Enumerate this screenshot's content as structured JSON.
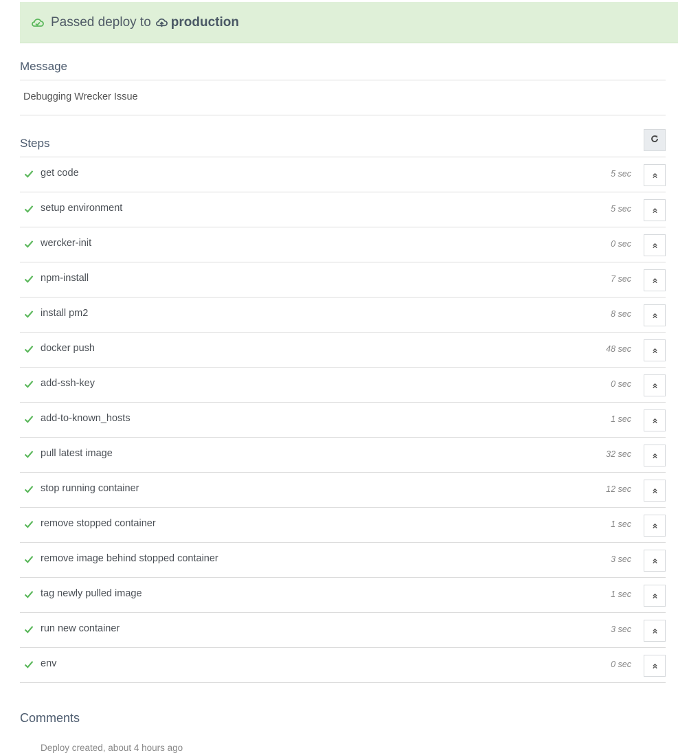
{
  "banner": {
    "status_text": "Passed deploy to",
    "target": "production",
    "status_icon": "cloud-check-icon",
    "target_icon": "cloud-upload-icon",
    "bg_color": "#dff0d8"
  },
  "message": {
    "title": "Message",
    "text": "Debugging Wrecker Issue"
  },
  "steps": {
    "title": "Steps",
    "refresh_icon": "refresh-icon",
    "items": [
      {
        "name": "get code",
        "duration": "5 sec"
      },
      {
        "name": "setup environment",
        "duration": "5 sec"
      },
      {
        "name": "wercker-init",
        "duration": "0 sec"
      },
      {
        "name": "npm-install",
        "duration": "7 sec"
      },
      {
        "name": "install pm2",
        "duration": "8 sec"
      },
      {
        "name": "docker push",
        "duration": "48 sec"
      },
      {
        "name": "add-ssh-key",
        "duration": "0 sec"
      },
      {
        "name": "add-to-known_hosts",
        "duration": "1 sec"
      },
      {
        "name": "pull latest image",
        "duration": "32 sec"
      },
      {
        "name": "stop running container",
        "duration": "12 sec"
      },
      {
        "name": "remove stopped container",
        "duration": "1 sec"
      },
      {
        "name": "remove image behind stopped container",
        "duration": "3 sec"
      },
      {
        "name": "tag newly pulled image",
        "duration": "1 sec"
      },
      {
        "name": "run new container",
        "duration": "3 sec"
      },
      {
        "name": "env",
        "duration": "0 sec"
      }
    ],
    "success_color": "#5cb85c"
  },
  "comments": {
    "title": "Comments",
    "entry": "Deploy created, about 4 hours ago"
  }
}
